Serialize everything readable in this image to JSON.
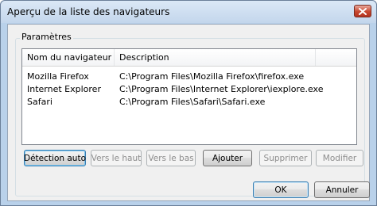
{
  "window": {
    "title": "Aperçu de la liste des navigateurs",
    "close_icon": "close-icon"
  },
  "group": {
    "label": "Paramètres"
  },
  "list": {
    "columns": [
      "Nom du navigateur",
      "Description",
      ""
    ],
    "rows": [
      {
        "name": "Mozilla Firefox",
        "description": "C:\\Program Files\\Mozilla Firefox\\firefox.exe"
      },
      {
        "name": "Internet Explorer",
        "description": "C:\\Program Files\\Internet Explorer\\iexplore.exe"
      },
      {
        "name": "Safari",
        "description": "C:\\Program Files\\Safari\\Safari.exe"
      }
    ]
  },
  "buttons": {
    "detect": "Détection auto",
    "move_up": "Vers le haut",
    "move_down": "Vers le bas",
    "add": "Ajouter",
    "delete": "Supprimer",
    "modify": "Modifier",
    "ok": "OK",
    "cancel": "Annuler"
  },
  "colors": {
    "close_button": "#c7472f",
    "focus_border": "#3c7fb1"
  }
}
